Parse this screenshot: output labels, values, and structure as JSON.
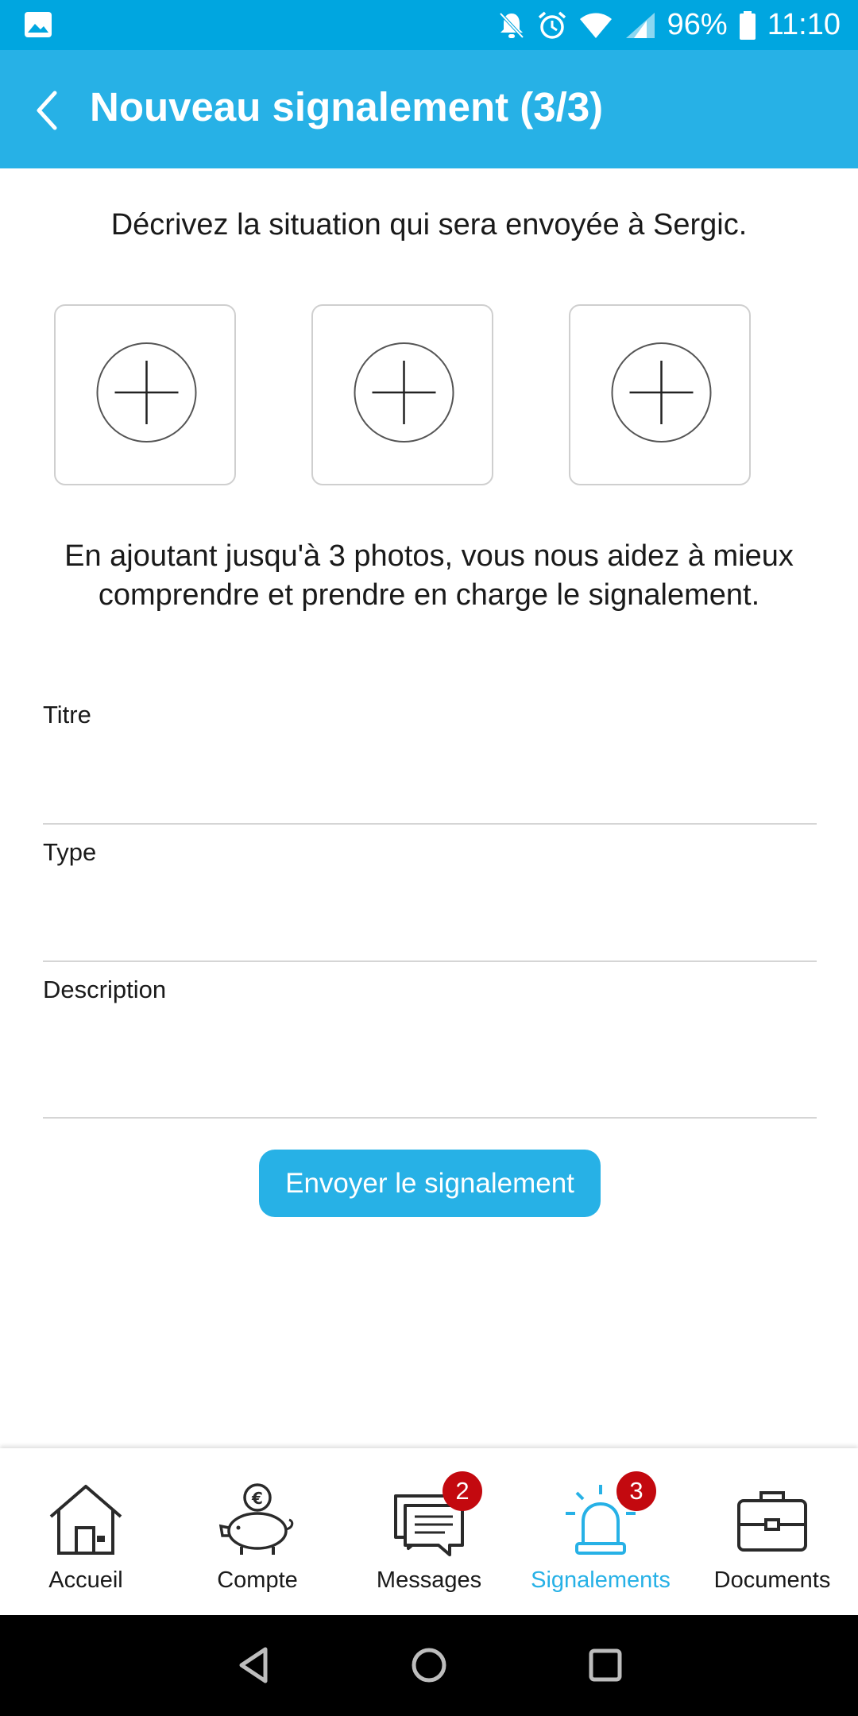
{
  "status_bar": {
    "battery": "96%",
    "time": "11:10",
    "icons": [
      "gallery-icon",
      "bell-off-icon",
      "alarm-icon",
      "wifi-icon",
      "signal-icon",
      "battery-icon"
    ]
  },
  "app_bar": {
    "title": "Nouveau signalement (3/3)",
    "back_icon": "chevron-left-icon"
  },
  "form": {
    "intro": "Décrivez la situation qui sera envoyée à Sergic.",
    "photo_slots": [
      {
        "icon": "add-photo-icon"
      },
      {
        "icon": "add-photo-icon"
      },
      {
        "icon": "add-photo-icon"
      }
    ],
    "help_text": "En ajoutant jusqu'à 3 photos, vous nous aidez à mieux comprendre et prendre en charge le signalement.",
    "fields": {
      "title": {
        "label": "Titre",
        "value": ""
      },
      "type": {
        "label": "Type",
        "value": ""
      },
      "description": {
        "label": "Description",
        "value": ""
      }
    },
    "submit_label": "Envoyer le signalement"
  },
  "bottom_nav": {
    "items": [
      {
        "label": "Accueil",
        "icon": "house-icon",
        "active": false
      },
      {
        "label": "Compte",
        "icon": "piggy-bank-icon",
        "active": false
      },
      {
        "label": "Messages",
        "icon": "messages-icon",
        "active": false,
        "badge": "2"
      },
      {
        "label": "Signalements",
        "icon": "siren-icon",
        "active": true,
        "badge": "3"
      },
      {
        "label": "Documents",
        "icon": "briefcase-icon",
        "active": false
      }
    ]
  },
  "system_nav": {
    "icons": [
      "back-triangle-icon",
      "home-circle-icon",
      "recents-square-icon"
    ]
  },
  "colors": {
    "status_bar": "#00a6e0",
    "app_bar": "#27b1e6",
    "accent": "#27b1e6",
    "badge": "#c3090f"
  }
}
